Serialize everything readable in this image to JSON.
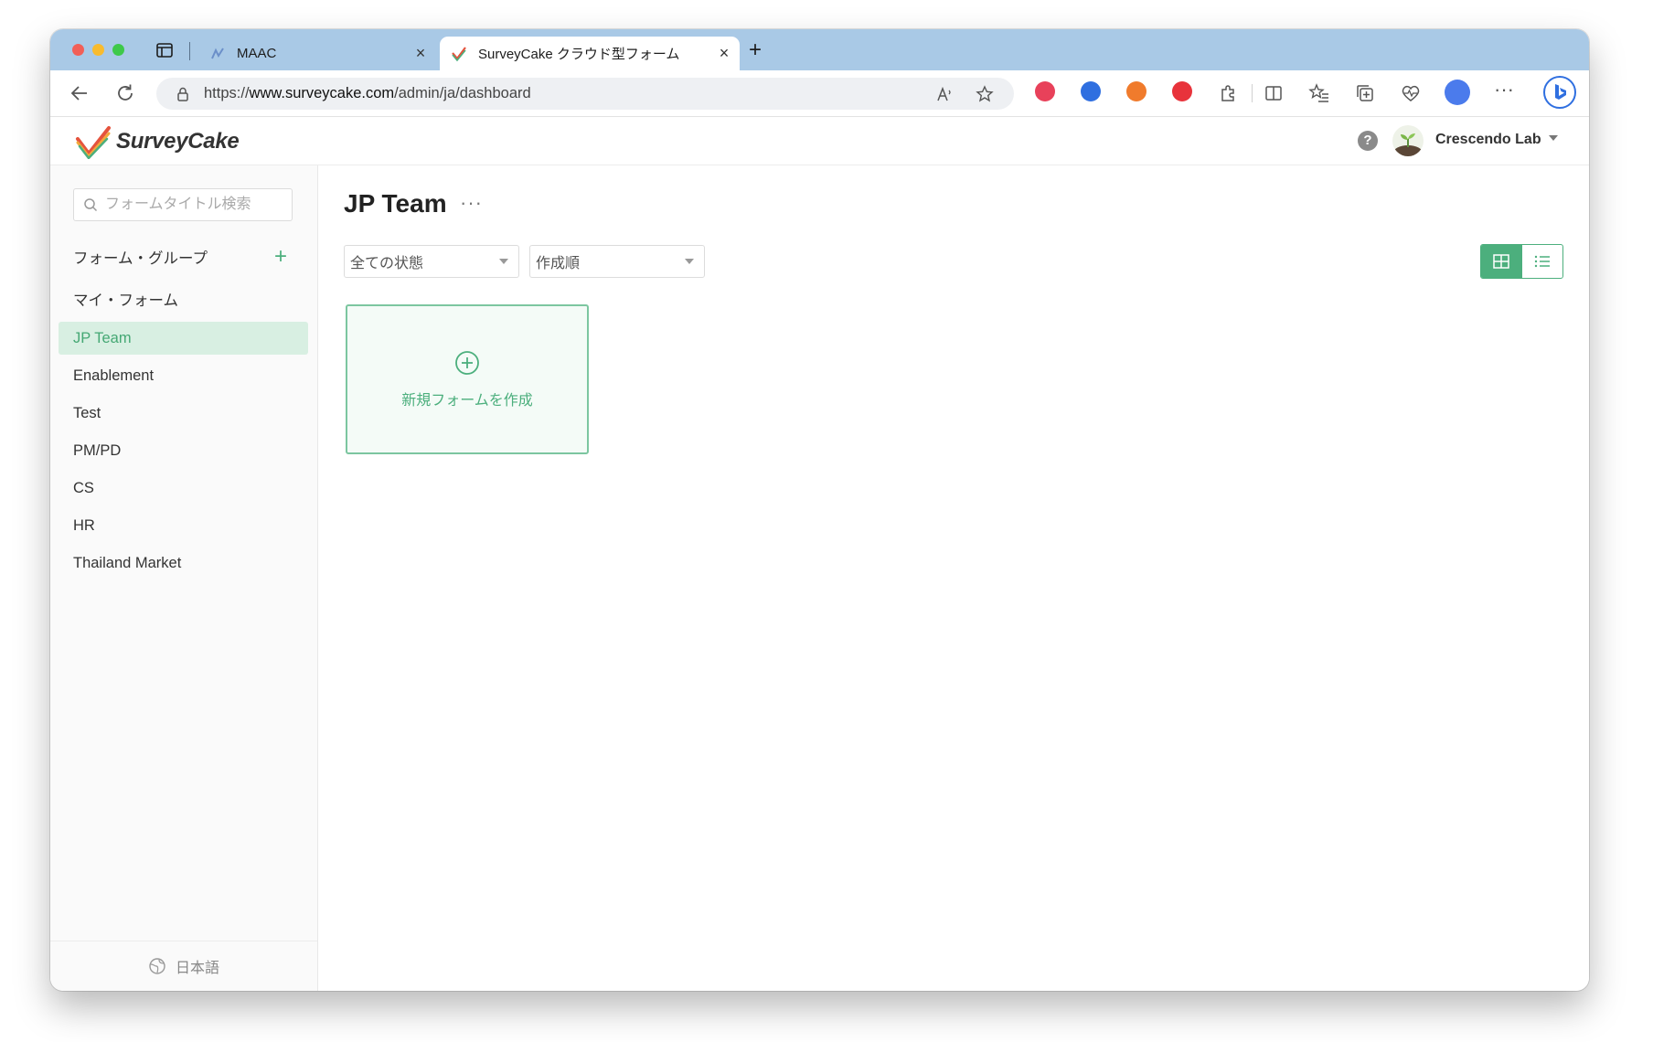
{
  "browser": {
    "tabs": [
      {
        "title": "MAAC",
        "active": false
      },
      {
        "title": "SurveyCake クラウド型フォーム",
        "active": true
      }
    ],
    "url_scheme": "https://",
    "url_host": "www.surveycake.com",
    "url_path": "/admin/ja/dashboard"
  },
  "header": {
    "logo_text": "SurveyCake",
    "help_symbol": "?",
    "account_name": "Crescendo Lab"
  },
  "sidebar": {
    "search_placeholder": "フォームタイトル検索",
    "group_label": "フォーム・グループ",
    "add_symbol": "+",
    "items": [
      {
        "label": "マイ・フォーム",
        "active": false
      },
      {
        "label": "JP Team",
        "active": true
      },
      {
        "label": "Enablement",
        "active": false
      },
      {
        "label": "Test",
        "active": false
      },
      {
        "label": "PM/PD",
        "active": false
      },
      {
        "label": "CS",
        "active": false
      },
      {
        "label": "HR",
        "active": false
      },
      {
        "label": "Thailand Market",
        "active": false
      }
    ],
    "language": "日本語"
  },
  "main": {
    "title": "JP Team",
    "more_symbol": "···",
    "status_filter": "全ての状態",
    "sort_filter": "作成順",
    "view_mode": "grid",
    "new_form_label": "新規フォームを作成"
  },
  "colors": {
    "accent": "#4caf7d",
    "active_bg": "#d8efe2",
    "tabstrip": "#a9c9e6"
  }
}
